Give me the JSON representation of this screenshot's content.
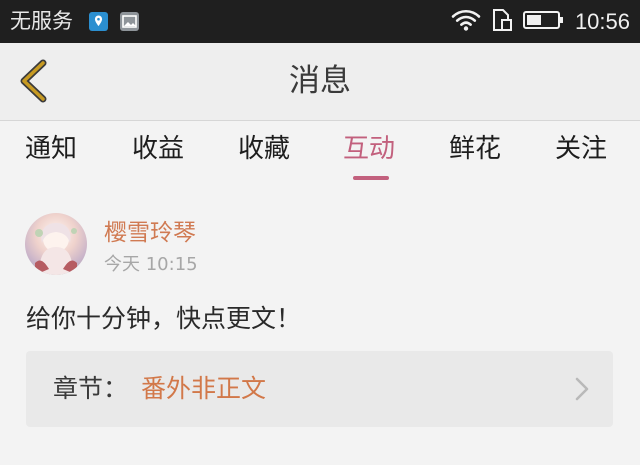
{
  "status_bar": {
    "carrier": "无服务",
    "time": "10:56",
    "icons": [
      "location-icon",
      "image-icon",
      "wifi-icon",
      "sim-icon",
      "battery-icon"
    ]
  },
  "header": {
    "title": "消息"
  },
  "tabs": [
    {
      "label": "通知",
      "active": false
    },
    {
      "label": "收益",
      "active": false
    },
    {
      "label": "收藏",
      "active": false
    },
    {
      "label": "互动",
      "active": true
    },
    {
      "label": "鲜花",
      "active": false
    },
    {
      "label": "关注",
      "active": false
    }
  ],
  "message": {
    "username": "樱雪玲琴",
    "time": "今天 10:15",
    "text": "给你十分钟，快点更文！",
    "chapter": {
      "label": "章节：",
      "title": "番外非正文"
    }
  },
  "colors": {
    "accent": "#c2607d",
    "username": "#d07a52",
    "chapter_title": "#d27849",
    "status_bar_bg": "#1f1f1f",
    "back_arrow": "#c79a22"
  }
}
